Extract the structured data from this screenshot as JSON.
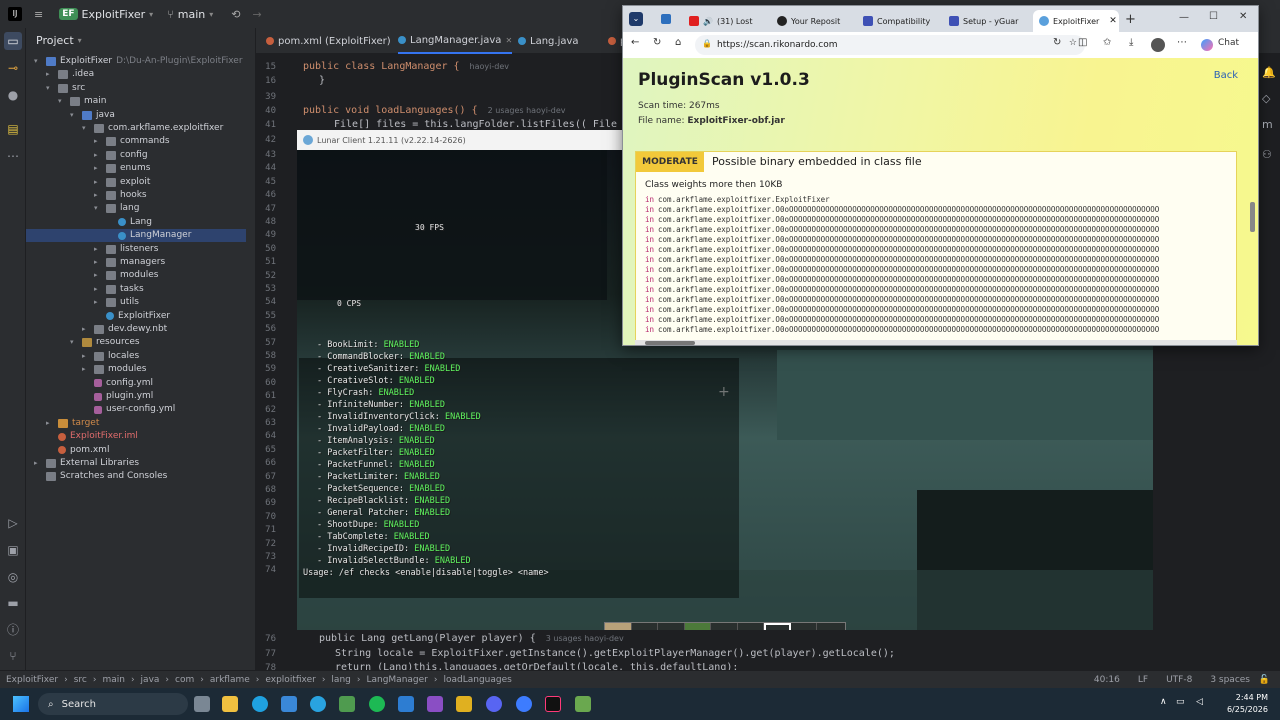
{
  "ide": {
    "project_badge": "EF",
    "project_name": "ExploitFixer",
    "branch": "main",
    "tool_window_label": "Project"
  },
  "project_tree": [
    {
      "label": "ExploitFixer",
      "extra": "D:\\Du-An-Plugin\\ExploitFixer",
      "depth": 0,
      "kind": "src",
      "open": true
    },
    {
      "label": ".idea",
      "depth": 1,
      "kind": "folder",
      "open": false
    },
    {
      "label": "src",
      "depth": 1,
      "kind": "folder",
      "open": true
    },
    {
      "label": "main",
      "depth": 2,
      "kind": "folder",
      "open": true
    },
    {
      "label": "java",
      "depth": 3,
      "kind": "src",
      "open": true
    },
    {
      "label": "com.arkflame.exploitfixer",
      "depth": 4,
      "kind": "folder",
      "open": true
    },
    {
      "label": "commands",
      "depth": 5,
      "kind": "folder",
      "open": false
    },
    {
      "label": "config",
      "depth": 5,
      "kind": "folder",
      "open": false
    },
    {
      "label": "enums",
      "depth": 5,
      "kind": "folder",
      "open": false
    },
    {
      "label": "exploit",
      "depth": 5,
      "kind": "folder",
      "open": false
    },
    {
      "label": "hooks",
      "depth": 5,
      "kind": "folder",
      "open": false
    },
    {
      "label": "lang",
      "depth": 5,
      "kind": "folder",
      "open": true
    },
    {
      "label": "Lang",
      "depth": 6,
      "kind": "java",
      "leaf": true
    },
    {
      "label": "LangManager",
      "depth": 6,
      "kind": "java",
      "leaf": true,
      "selected": true
    },
    {
      "label": "listeners",
      "depth": 5,
      "kind": "folder",
      "open": false
    },
    {
      "label": "managers",
      "depth": 5,
      "kind": "folder",
      "open": false
    },
    {
      "label": "modules",
      "depth": 5,
      "kind": "folder",
      "open": false
    },
    {
      "label": "tasks",
      "depth": 5,
      "kind": "folder",
      "open": false
    },
    {
      "label": "utils",
      "depth": 5,
      "kind": "folder",
      "open": false
    },
    {
      "label": "ExploitFixer",
      "depth": 5,
      "kind": "java",
      "leaf": true
    },
    {
      "label": "dev.dewy.nbt",
      "depth": 4,
      "kind": "folder",
      "open": false
    },
    {
      "label": "resources",
      "depth": 3,
      "kind": "res",
      "open": true
    },
    {
      "label": "locales",
      "depth": 4,
      "kind": "folder",
      "open": false
    },
    {
      "label": "modules",
      "depth": 4,
      "kind": "folder",
      "open": false
    },
    {
      "label": "config.yml",
      "depth": 4,
      "kind": "yml",
      "leaf": true
    },
    {
      "label": "plugin.yml",
      "depth": 4,
      "kind": "yml",
      "leaf": true
    },
    {
      "label": "user-config.yml",
      "depth": 4,
      "kind": "yml",
      "leaf": true
    },
    {
      "label": "target",
      "depth": 1,
      "kind": "excl",
      "open": false,
      "style": "orange"
    },
    {
      "label": "ExploitFixer.iml",
      "depth": 1,
      "kind": "xml",
      "leaf": true,
      "style": "red"
    },
    {
      "label": "pom.xml",
      "depth": 1,
      "kind": "xml",
      "leaf": true
    },
    {
      "label": "External Libraries",
      "depth": 0,
      "kind": "folder",
      "open": false
    },
    {
      "label": "Scratches and Consoles",
      "depth": 0,
      "kind": "folder",
      "open": false,
      "noarrow": true
    }
  ],
  "editor_tabs": [
    {
      "label": "pom.xml (ExploitFixer)",
      "kind": "xml"
    },
    {
      "label": "LangManager.java",
      "kind": "java",
      "active": true
    },
    {
      "label": "Lang.java",
      "kind": "java"
    },
    {
      "label": "pl",
      "kind": "xml"
    }
  ],
  "code_top": [
    {
      "num": "15",
      "text": "public class LangManager {",
      "hint": "haoyi-dev"
    },
    {
      "num": "16",
      "text": "}"
    },
    {
      "num": "39",
      "text": ""
    },
    {
      "num": "40",
      "text": "public void loadLanguages() {",
      "hint": "2 usages   haoyi-dev"
    },
    {
      "num": "41",
      "text": "File[] files = this.langFolder.listFiles(( File dir,"
    },
    {
      "num": "42",
      "text": ""
    }
  ],
  "gutter_numbers": [
    "43",
    "44",
    "45",
    "46",
    "47",
    "48",
    "49",
    "50",
    "51",
    "52",
    "53",
    "54",
    "55",
    "56",
    "57",
    "58",
    "59",
    "60",
    "61",
    "62",
    "63",
    "64",
    "65",
    "66",
    "67",
    "68",
    "69",
    "70",
    "71",
    "72",
    "73",
    "74"
  ],
  "code_bottom": [
    {
      "num": "76",
      "text": "public Lang getLang(Player player) {",
      "hint": "3 usages   haoyi-dev"
    },
    {
      "num": "77",
      "text": "String locale = ExploitFixer.getInstance().getExploitPlayerManager().get(player).getLocale();"
    },
    {
      "num": "78",
      "text": "return (Lang)this.languages.getOrDefault(locale, this.defaultLang);"
    }
  ],
  "minecraft": {
    "title": "Lunar Client 1.21.11 (v2.22.14-2626)",
    "fps": "30 FPS",
    "cps": "0 CPS",
    "enabled_word": "ENABLED",
    "checks": [
      "BookLimit",
      "CommandBlocker",
      "CreativeSanitizer",
      "CreativeSlot",
      "FlyCrash",
      "InfiniteNumber",
      "InvalidInventoryClick",
      "InvalidPayload",
      "ItemAnalysis",
      "PacketFilter",
      "PacketFunnel",
      "PacketLimiter",
      "PacketSequence",
      "RecipeBlacklist",
      "General Patcher",
      "ShootDupe",
      "TabComplete",
      "InvalidRecipeID",
      "InvalidSelectBundle"
    ],
    "usage": "Usage: /ef checks <enable|disable|toggle> <name>"
  },
  "browser": {
    "tabs": [
      "(31) Lost",
      "Your Reposit",
      "Compatibility",
      "Setup - yGuar",
      "ExploitFixer"
    ],
    "url": "https://scan.rikonardo.com",
    "chat_label": "Chat",
    "page": {
      "title": "PluginScan v1.0.3",
      "back": "Back",
      "scan_time_label": "Scan time:",
      "scan_time": "267ms",
      "file_name_label": "File name:",
      "file_name": "ExploitFixer-obf.jar",
      "severity": "MODERATE",
      "finding_title": "Possible binary embedded in class file",
      "finding_sub": "Class weights more then 10KB",
      "finding_prefix": "in",
      "finding_lines": [
        "com.arkflame.exploitfixer.ExploitFixer",
        "com.arkflame.exploitfixer.O0oOOOOOOOOOOOOOOOOOOOOOOOOOOOOOOOOOOOOOOOOOOOOOOOOOOOOOOOOOOOOOOOOOOOOOOOOOOOOOOOOOO",
        "com.arkflame.exploitfixer.O0oOOOOOOOOOOOOOOOOOOOOOOOOOOOOOOOOOOOOOOOOOOOOOOOOOOOOOOOOOOOOOOOOOOOOOOOOOOOOOOOOOO",
        "com.arkflame.exploitfixer.O0oOOOOOOOOOOOOOOOOOOOOOOOOOOOOOOOOOOOOOOOOOOOOOOOOOOOOOOOOOOOOOOOOOOOOOOOOOOOOOOOOOO",
        "com.arkflame.exploitfixer.O0oOOOOOOOOOOOOOOOOOOOOOOOOOOOOOOOOOOOOOOOOOOOOOOOOOOOOOOOOOOOOOOOOOOOOOOOOOOOOOOOOOO",
        "com.arkflame.exploitfixer.O0oOOOOOOOOOOOOOOOOOOOOOOOOOOOOOOOOOOOOOOOOOOOOOOOOOOOOOOOOOOOOOOOOOOOOOOOOOOOOOOOOOO",
        "com.arkflame.exploitfixer.O0oOOOOOOOOOOOOOOOOOOOOOOOOOOOOOOOOOOOOOOOOOOOOOOOOOOOOOOOOOOOOOOOOOOOOOOOOOOOOOOOOOO",
        "com.arkflame.exploitfixer.O0oOOOOOOOOOOOOOOOOOOOOOOOOOOOOOOOOOOOOOOOOOOOOOOOOOOOOOOOOOOOOOOOOOOOOOOOOOOOOOOOOOO",
        "com.arkflame.exploitfixer.O0oOOOOOOOOOOOOOOOOOOOOOOOOOOOOOOOOOOOOOOOOOOOOOOOOOOOOOOOOOOOOOOOOOOOOOOOOOOOOOOOOOO",
        "com.arkflame.exploitfixer.O0oOOOOOOOOOOOOOOOOOOOOOOOOOOOOOOOOOOOOOOOOOOOOOOOOOOOOOOOOOOOOOOOOOOOOOOOOOOOOOOOOOO",
        "com.arkflame.exploitfixer.O0oOOOOOOOOOOOOOOOOOOOOOOOOOOOOOOOOOOOOOOOOOOOOOOOOOOOOOOOOOOOOOOOOOOOOOOOOOOOOOOOOOO",
        "com.arkflame.exploitfixer.O0oOOOOOOOOOOOOOOOOOOOOOOOOOOOOOOOOOOOOOOOOOOOOOOOOOOOOOOOOOOOOOOOOOOOOOOOOOOOOOOOOOO",
        "com.arkflame.exploitfixer.O0oOOOOOOOOOOOOOOOOOOOOOOOOOOOOOOOOOOOOOOOOOOOOOOOOOOOOOOOOOOOOOOOOOOOOOOOOOOOOOOOOOO",
        "com.arkflame.exploitfixer.O0oOOOOOOOOOOOOOOOOOOOOOOOOOOOOOOOOOOOOOOOOOOOOOOOOOOOOOOOOOOOOOOOOOOOOOOOOOOOOOOOOOO"
      ]
    }
  },
  "statusbar": {
    "crumbs": [
      "ExploitFixer",
      "src",
      "main",
      "java",
      "com",
      "arkflame",
      "exploitfixer",
      "lang",
      "LangManager",
      "loadLanguages"
    ],
    "position": "40:16",
    "line_sep": "LF",
    "encoding": "UTF-8",
    "indent": "3 spaces"
  },
  "taskbar": {
    "search": "Search",
    "time": "2:44 PM",
    "date": "6/25/2026"
  },
  "colors": {
    "ide_bg": "#1e1f22",
    "enabled_green": "#5ff55f",
    "moderate": "#f2c93a"
  }
}
